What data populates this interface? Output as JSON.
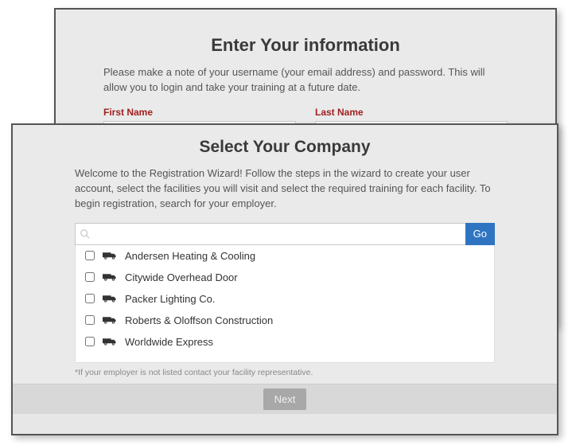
{
  "back": {
    "title": "Enter Your information",
    "subtitle": "Please make a note of your username (your email address) and password. This will allow you to login and take your training at a future date.",
    "first_name_label": "First Name",
    "last_name_label": "Last Name",
    "first_name_value": "",
    "last_name_value": ""
  },
  "front": {
    "title": "Select Your Company",
    "subtitle": "Welcome to the Registration Wizard! Follow the steps in the wizard to create your user account, select the facilities you will visit and select the required training for each facility. To begin registration, search for your employer.",
    "search_value": "",
    "go_label": "Go",
    "companies": [
      "Andersen Heating & Cooling",
      "Citywide Overhead Door",
      "Packer Lighting Co.",
      "Roberts & Oloffson Construction",
      "Worldwide Express"
    ],
    "footnote": "*If your employer is not listed contact your facility representative.",
    "next_label": "Next"
  }
}
